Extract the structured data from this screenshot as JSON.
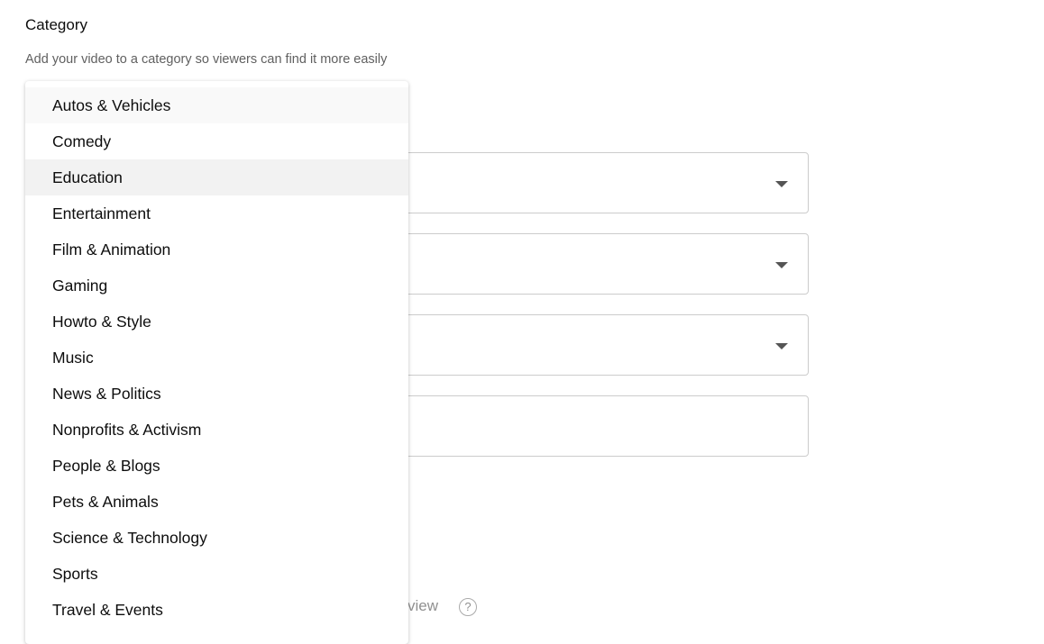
{
  "section": {
    "title": "Category",
    "subtitle": "Add your video to a category so viewers can find it more easily"
  },
  "background": {
    "partial_label": "view",
    "help_icon": "?"
  },
  "dropdown": {
    "items": [
      "Autos & Vehicles",
      "Comedy",
      "Education",
      "Entertainment",
      "Film & Animation",
      "Gaming",
      "Howto & Style",
      "Music",
      "News & Politics",
      "Nonprofits & Activism",
      "People & Blogs",
      "Pets & Animals",
      "Science & Technology",
      "Sports",
      "Travel & Events"
    ],
    "hovered": "Autos & Vehicles",
    "selected": "Education"
  }
}
